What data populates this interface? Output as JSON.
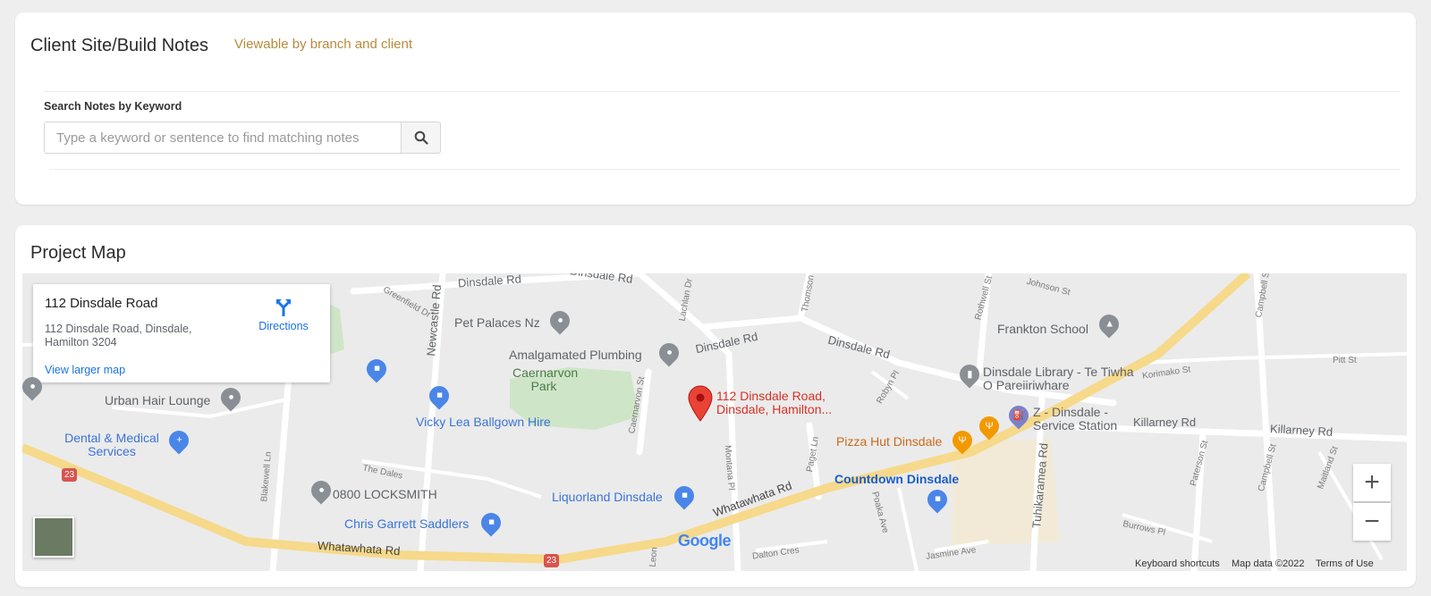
{
  "notes": {
    "title": "Client Site/Build Notes",
    "subtitle": "Viewable by branch and client",
    "search_label": "Search Notes by Keyword",
    "search_placeholder": "Type a keyword or sentence to find matching notes",
    "search_value": ""
  },
  "map_card": {
    "title": "Project Map"
  },
  "info_window": {
    "name": "112 Dinsdale Road",
    "address": "112 Dinsdale Road, Dinsdale, Hamilton 3204",
    "directions_label": "Directions",
    "larger_map_label": "View larger map"
  },
  "map": {
    "marker_label": "112 Dinsdale Road, Dinsdale, Hamilton...",
    "places": {
      "pet_palaces": "Pet Palaces Nz",
      "amalgamated": "Amalgamated Plumbing",
      "caernarvon": "Caernarvon Park",
      "urban_hair": "Urban Hair Lounge",
      "vicky_lea": "Vicky Lea Ballgown Hire",
      "dental": "Dental & Medical Services",
      "locksmith": "0800 LOCKSMITH",
      "chris_garrett": "Chris Garrett Saddlers",
      "liquorland": "Liquorland Dinsdale",
      "frankton_school": "Frankton School",
      "library": "Dinsdale Library - Te Tiwha O Pareiiriwhare",
      "z_station": "Z - Dinsdale - Service Station",
      "pizza_hut": "Pizza Hut Dinsdale",
      "countdown": "Countdown Dinsdale"
    },
    "streets": {
      "dinsdale_rd_1": "Dinsdale Rd",
      "dinsdale_rd_2": "Dinsdale Rd",
      "dinsdale_rd_3": "Dinsdale Rd",
      "dinsdale_rd_4": "Dinsdale Rd",
      "whatawhata_1": "Whatawhata Rd",
      "whatawhata_2": "Whatawhata Rd",
      "killarney_1": "Killarney Rd",
      "killarney_2": "Killarney Rd",
      "newcastle": "Newcastle Rd",
      "tuhikaramea": "Tuhikaramea Rd",
      "greenfield": "Greenfield Dr",
      "lachlan": "Lachlan Dr",
      "thomson": "Thomson",
      "rothwell": "Rothwell St",
      "johnson": "Johnson St",
      "campbell_1": "Campbell St",
      "campbell_2": "Campbell St",
      "pitt": "Pitt St",
      "korimako": "Korimako St",
      "robyn": "Robyn Pl",
      "caernarvon_st": "Caernarvon St",
      "paget": "Paget Ln",
      "montana": "Montana Pl",
      "poaka": "Poaka Ave",
      "paterson": "Paterson St",
      "burrows": "Burrows Pl",
      "maitland": "Maitland St",
      "the_dales": "The Dales",
      "blakewell": "Blakewell Ln",
      "dalton": "Dalton Cres",
      "jasmine": "Jasmine Ave",
      "leon": "Leon",
      "route_1": "23",
      "route_2": "23"
    },
    "zoom_in": "+",
    "zoom_out": "−",
    "google": "Google",
    "footer": {
      "shortcuts": "Keyboard shortcuts",
      "map_data": "Map data ©2022",
      "terms": "Terms of Use"
    }
  },
  "colors": {
    "accent_subtitle": "#b98a3e",
    "link_blue": "#1a73e8",
    "marker_red": "#ea4335",
    "highway_yellow": "#f6d98a"
  }
}
